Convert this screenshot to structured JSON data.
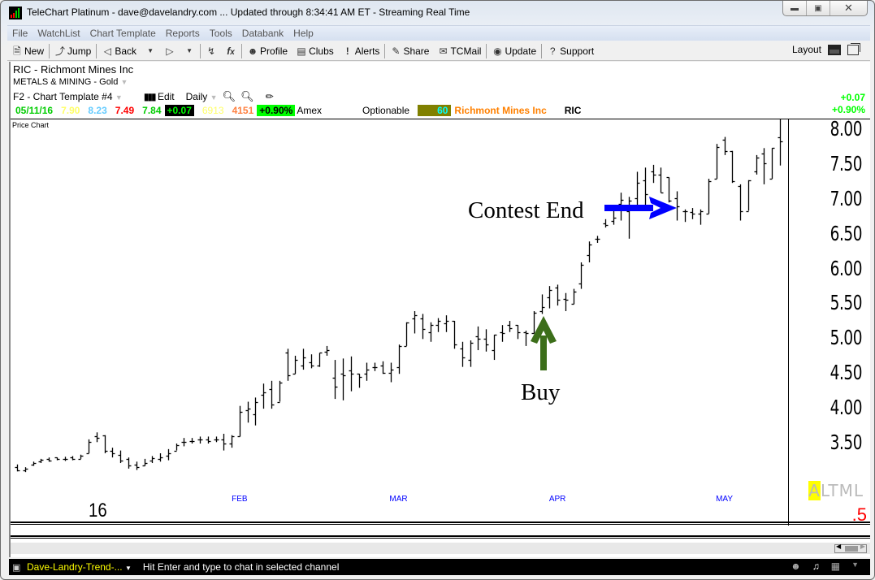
{
  "window": {
    "title": "TeleChart Platinum - dave@davelandry.com  ... Updated through 8:34:41 AM ET  -  Streaming Real Time",
    "controls": [
      "minimize",
      "maximize",
      "close"
    ]
  },
  "menu": [
    "File",
    "WatchList",
    "Chart Template",
    "Reports",
    "Tools",
    "Databank",
    "Help"
  ],
  "toolbar": {
    "new": "New",
    "jump": "Jump",
    "back": "Back",
    "profile": "Profile",
    "clubs": "Clubs",
    "alerts": "Alerts",
    "share": "Share",
    "tcmail": "TCMail",
    "update": "Update",
    "support": "Support",
    "layout": "Layout"
  },
  "header": {
    "symbol_line": "RIC  -  Richmont Mines Inc",
    "industry": "METALS & MINING - Gold",
    "template": "F2 - Chart Template #4",
    "edit": "Edit",
    "period": "Daily"
  },
  "quote": {
    "date": "05/11/16",
    "open": "7.90",
    "high": "8.23",
    "low": "7.49",
    "close": "7.84",
    "change": "+0.07",
    "volume": "6913",
    "avg_volume": "4151",
    "pct_change": "+0.90%",
    "exchange": "Amex",
    "optionable": "Optionable",
    "rank": "60",
    "company": "Richmont Mines Inc",
    "ticker": "RIC",
    "change_right": "+0.07",
    "pct_right": "+0.90%",
    "colors": {
      "date": "#00cc00",
      "open": "#ffff66",
      "high": "#66ccff",
      "low": "#ff0000",
      "close": "#00cc00",
      "volume": "#ffff66",
      "avg_volume": "#ff8040",
      "company": "#ff8000"
    }
  },
  "chart_panel_label": "Price Chart",
  "annotations": {
    "contest_end": "Contest End",
    "buy": "Buy",
    "contest_arrow_color": "#0000ff",
    "buy_arrow_color": "#3c6e1a"
  },
  "altml": {
    "letters": [
      "A",
      "L",
      "T",
      "M",
      "L"
    ],
    "highlighted": "A"
  },
  "scale_note": ".5",
  "chat": {
    "channel": "Dave-Landry-Trend-...",
    "hint": "Hit Enter and type to chat in selected channel"
  },
  "chart_data": {
    "type": "ohlc",
    "title": "RIC - Richmont Mines Inc (Daily)",
    "ylim": [
      3.0,
      8.2
    ],
    "yticks": [
      "8.00",
      "7.50",
      "7.00",
      "6.50",
      "6.00",
      "5.50",
      "5.00",
      "4.50",
      "4.00",
      "3.50"
    ],
    "ytick_values": [
      8.0,
      7.5,
      7.0,
      6.5,
      6.0,
      5.5,
      5.0,
      4.5,
      4.0,
      3.5
    ],
    "xlabels": [
      {
        "label": "16",
        "bar": 10,
        "kind": "year"
      },
      {
        "label": "FEB",
        "bar": 28,
        "kind": "month"
      },
      {
        "label": "MAR",
        "bar": 48,
        "kind": "month"
      },
      {
        "label": "APR",
        "bar": 68,
        "kind": "month"
      },
      {
        "label": "MAY",
        "bar": 89,
        "kind": "month"
      }
    ],
    "bars": [
      [
        3.16,
        3.2,
        3.1,
        3.12
      ],
      [
        3.12,
        3.16,
        3.09,
        3.14
      ],
      [
        3.2,
        3.24,
        3.18,
        3.22
      ],
      [
        3.24,
        3.28,
        3.22,
        3.27
      ],
      [
        3.28,
        3.3,
        3.24,
        3.26
      ],
      [
        3.3,
        3.3,
        3.26,
        3.28
      ],
      [
        3.28,
        3.31,
        3.25,
        3.28
      ],
      [
        3.3,
        3.32,
        3.26,
        3.28
      ],
      [
        3.28,
        3.34,
        3.28,
        3.32
      ],
      [
        3.36,
        3.56,
        3.36,
        3.52
      ],
      [
        3.6,
        3.66,
        3.52,
        3.58
      ],
      [
        3.62,
        3.62,
        3.36,
        3.4
      ],
      [
        3.4,
        3.44,
        3.3,
        3.36
      ],
      [
        3.34,
        3.4,
        3.22,
        3.26
      ],
      [
        3.28,
        3.3,
        3.14,
        3.18
      ],
      [
        3.2,
        3.24,
        3.12,
        3.16
      ],
      [
        3.18,
        3.28,
        3.18,
        3.22
      ],
      [
        3.25,
        3.32,
        3.22,
        3.29
      ],
      [
        3.28,
        3.36,
        3.24,
        3.3
      ],
      [
        3.32,
        3.42,
        3.26,
        3.36
      ],
      [
        3.4,
        3.5,
        3.4,
        3.48
      ],
      [
        3.52,
        3.58,
        3.46,
        3.52
      ],
      [
        3.54,
        3.58,
        3.5,
        3.54
      ],
      [
        3.56,
        3.6,
        3.5,
        3.56
      ],
      [
        3.56,
        3.6,
        3.5,
        3.54
      ],
      [
        3.56,
        3.6,
        3.52,
        3.56
      ],
      [
        3.56,
        3.64,
        3.4,
        3.5
      ],
      [
        3.5,
        3.62,
        3.44,
        3.6
      ],
      [
        3.6,
        4.04,
        3.6,
        3.96
      ],
      [
        3.98,
        4.1,
        3.8,
        4.0
      ],
      [
        3.92,
        4.16,
        3.76,
        4.1
      ],
      [
        4.2,
        4.36,
        4.0,
        4.24
      ],
      [
        4.28,
        4.4,
        4.0,
        4.06
      ],
      [
        4.1,
        4.4,
        4.1,
        4.38
      ],
      [
        4.8,
        4.86,
        4.4,
        4.48
      ],
      [
        4.5,
        4.76,
        4.5,
        4.7
      ],
      [
        4.62,
        4.86,
        4.56,
        4.74
      ],
      [
        4.66,
        4.78,
        4.58,
        4.62
      ],
      [
        4.62,
        4.8,
        4.6,
        4.8
      ],
      [
        4.82,
        4.9,
        4.76,
        4.84
      ],
      [
        4.44,
        4.7,
        4.14,
        4.32
      ],
      [
        4.5,
        4.72,
        4.12,
        4.48
      ],
      [
        4.55,
        4.75,
        4.25,
        4.5
      ],
      [
        4.5,
        4.5,
        4.3,
        4.46
      ],
      [
        4.5,
        4.66,
        4.4,
        4.56
      ],
      [
        4.6,
        4.66,
        4.54,
        4.6
      ],
      [
        4.62,
        4.68,
        4.5,
        4.52
      ],
      [
        4.52,
        4.66,
        4.38,
        4.56
      ],
      [
        4.6,
        4.92,
        4.5,
        4.9
      ],
      [
        4.9,
        5.24,
        4.9,
        5.24
      ],
      [
        5.3,
        5.4,
        5.08,
        5.34
      ],
      [
        5.3,
        5.36,
        5.0,
        5.14
      ],
      [
        5.1,
        5.24,
        4.96,
        5.2
      ],
      [
        5.2,
        5.3,
        5.1,
        5.26
      ],
      [
        5.22,
        5.34,
        5.1,
        5.26
      ],
      [
        5.26,
        5.24,
        4.86,
        4.92
      ],
      [
        4.86,
        4.96,
        4.6,
        4.74
      ],
      [
        4.7,
        4.98,
        4.6,
        4.94
      ],
      [
        5.04,
        5.18,
        4.84,
        5.0
      ],
      [
        5.0,
        5.14,
        4.82,
        4.92
      ],
      [
        4.84,
        5.06,
        4.7,
        5.06
      ],
      [
        5.1,
        5.2,
        4.96,
        5.08
      ],
      [
        5.2,
        5.26,
        5.1,
        5.16
      ],
      [
        5.2,
        5.2,
        5.0,
        5.1
      ],
      [
        5.1,
        5.12,
        4.9,
        5.08
      ],
      [
        5.08,
        5.4,
        5.2,
        5.38
      ],
      [
        5.4,
        5.64,
        5.36,
        5.46
      ],
      [
        5.6,
        5.76,
        5.44,
        5.7
      ],
      [
        5.74,
        5.78,
        5.48,
        5.56
      ],
      [
        5.58,
        5.66,
        5.4,
        5.56
      ],
      [
        5.5,
        5.72,
        5.5,
        5.68
      ],
      [
        5.8,
        6.1,
        5.72,
        6.06
      ],
      [
        6.2,
        6.4,
        6.1,
        6.36
      ],
      [
        6.44,
        6.48,
        6.38,
        6.44
      ],
      [
        6.66,
        6.72,
        6.6,
        6.64
      ],
      [
        6.7,
        6.84,
        6.64,
        6.74
      ],
      [
        6.94,
        7.1,
        6.7,
        7.0
      ],
      [
        6.84,
        7.04,
        6.44,
        6.98
      ],
      [
        7.02,
        7.4,
        6.92,
        7.24
      ],
      [
        7.28,
        7.46,
        6.9,
        7.08
      ],
      [
        7.4,
        7.5,
        7.24,
        7.36
      ],
      [
        7.36,
        7.46,
        7.1,
        7.1
      ],
      [
        7.32,
        7.32,
        6.96,
        6.98
      ],
      [
        7.02,
        7.12,
        6.7,
        6.9
      ],
      [
        6.84,
        6.86,
        6.68,
        6.84
      ],
      [
        6.82,
        6.88,
        6.72,
        6.8
      ],
      [
        6.8,
        6.86,
        6.64,
        6.84
      ],
      [
        6.8,
        7.3,
        6.8,
        7.26
      ],
      [
        7.3,
        7.8,
        7.3,
        7.76
      ],
      [
        7.86,
        7.9,
        7.64,
        7.7
      ],
      [
        7.7,
        7.64,
        7.24,
        7.26
      ],
      [
        7.2,
        7.22,
        6.7,
        6.84
      ],
      [
        6.84,
        7.18,
        6.84,
        7.28
      ],
      [
        7.4,
        7.64,
        7.36,
        7.6
      ],
      [
        7.66,
        7.74,
        7.22,
        7.52
      ],
      [
        7.3,
        7.66,
        7.3,
        7.74
      ],
      [
        7.9,
        8.23,
        7.49,
        7.84
      ]
    ]
  }
}
